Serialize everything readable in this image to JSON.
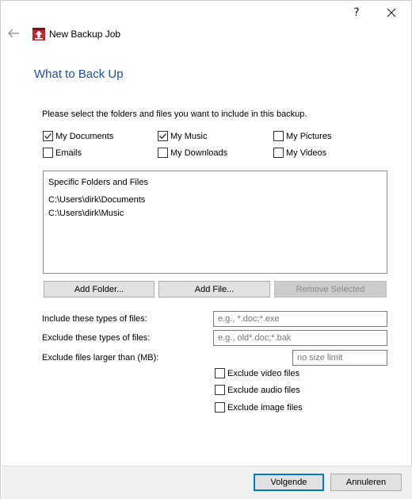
{
  "titlebar": {
    "help_label": "?",
    "close_label": "✕"
  },
  "header": {
    "app_title": "New Backup Job",
    "page_heading": "What to Back Up"
  },
  "instructions": "Please select the folders and files you want to include in this backup.",
  "checkboxes": [
    {
      "label": "My Documents",
      "checked": true
    },
    {
      "label": "My Music",
      "checked": true
    },
    {
      "label": "My Pictures",
      "checked": false
    },
    {
      "label": "Emails",
      "checked": false
    },
    {
      "label": "My Downloads",
      "checked": false
    },
    {
      "label": "My Videos",
      "checked": false
    }
  ],
  "list": {
    "header": "Specific Folders and Files",
    "items": [
      "C:\\Users\\dirk\\Documents",
      "C:\\Users\\dirk\\Music"
    ]
  },
  "list_buttons": {
    "add_folder": "Add Folder...",
    "add_file": "Add File...",
    "remove_selected": "Remove Selected"
  },
  "filters": {
    "include_label": "Include these types of files:",
    "include_placeholder": "e.g., *.doc;*.exe",
    "exclude_label": "Exclude these types of files:",
    "exclude_placeholder": "e.g., old*.doc;*.bak",
    "size_label": "Exclude files larger than (MB):",
    "size_placeholder": "no size limit"
  },
  "exclude_options": [
    {
      "label": "Exclude video files",
      "checked": false
    },
    {
      "label": "Exclude audio files",
      "checked": false
    },
    {
      "label": "Exclude image files",
      "checked": false
    }
  ],
  "footer": {
    "next_label": "Volgende",
    "cancel_label": "Annuleren"
  },
  "colors": {
    "heading": "#1f4e9c",
    "accent": "#0078d7",
    "app_icon": "#c0262d"
  }
}
